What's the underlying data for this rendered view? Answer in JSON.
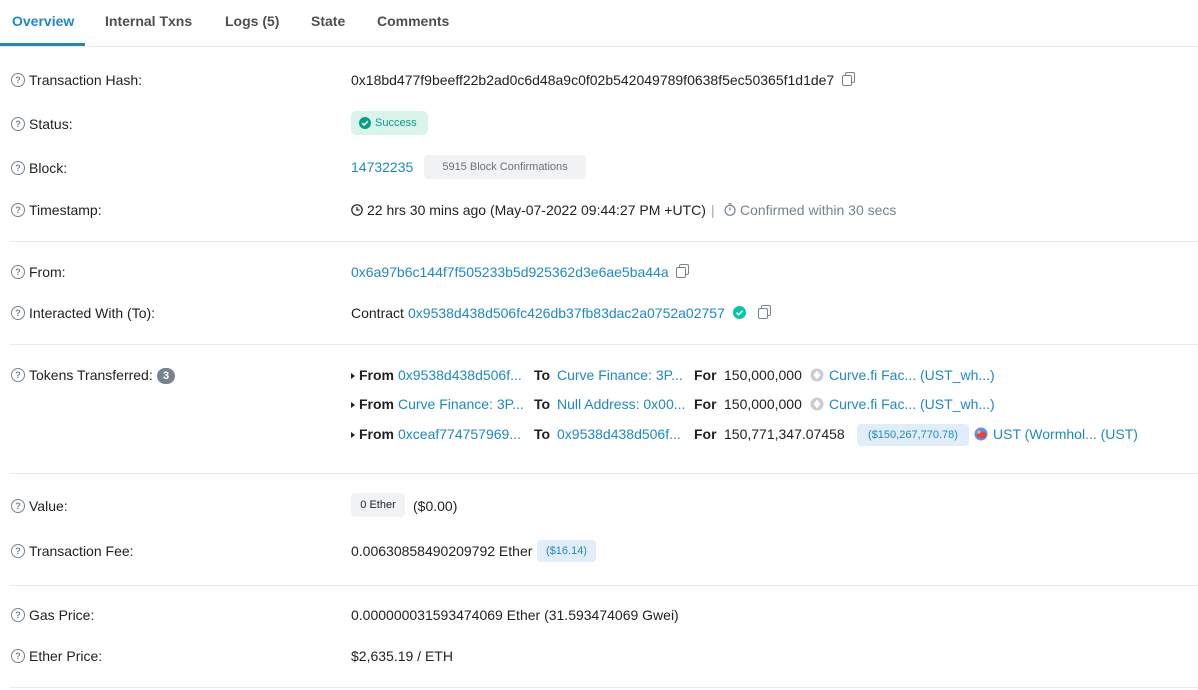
{
  "tabs": [
    "Overview",
    "Internal Txns",
    "Logs (5)",
    "State",
    "Comments"
  ],
  "rows": {
    "tx_hash": {
      "label": "Transaction Hash:",
      "value": "0x18bd477f9beeff22b2ad0c6d48a9c0f02b542049789f0638f5ec50365f1d1de7"
    },
    "status": {
      "label": "Status:",
      "value": "Success"
    },
    "block": {
      "label": "Block:",
      "value": "14732235",
      "confirmations": "5915 Block Confirmations"
    },
    "timestamp": {
      "label": "Timestamp:",
      "value": "22 hrs 30 mins ago (May-07-2022 09:44:27 PM +UTC)",
      "separator": "|",
      "confirmed": "Confirmed within 30 secs"
    },
    "from": {
      "label": "From:",
      "value": "0x6a97b6c144f7f505233b5d925362d3e6ae5ba44a"
    },
    "to": {
      "label": "Interacted With (To):",
      "prefix": "Contract",
      "value": "0x9538d438d506fc426db37fb83dac2a0752a02757"
    },
    "tokens": {
      "label": "Tokens Transferred:",
      "count": "3"
    },
    "value": {
      "label": "Value:",
      "amount": "0 Ether",
      "usd": "($0.00)"
    },
    "fee": {
      "label": "Transaction Fee:",
      "amount": "0.00630858490209792 Ether",
      "usd": "($16.14)"
    },
    "gas": {
      "label": "Gas Price:",
      "value": "0.000000031593474069 Ether (31.593474069 Gwei)"
    },
    "ether_price": {
      "label": "Ether Price:",
      "value": "$2,635.19 / ETH"
    }
  },
  "transfers": [
    {
      "from_kw": "From",
      "from": "0x9538d438d506f...",
      "to_kw": "To",
      "to": "Curve Finance: 3P...",
      "for_kw": "For",
      "amount": "150,000,000",
      "usd": "",
      "token": "Curve.fi Fac... (UST_wh...)"
    },
    {
      "from_kw": "From",
      "from": "Curve Finance: 3P...",
      "to_kw": "To",
      "to": "Null Address: 0x00...",
      "for_kw": "For",
      "amount": "150,000,000",
      "usd": "",
      "token": "Curve.fi Fac... (UST_wh...)"
    },
    {
      "from_kw": "From",
      "from": "0xceaf774757969...",
      "to_kw": "To",
      "to": "0x9538d438d506f...",
      "for_kw": "For",
      "amount": "150,771,347.07458",
      "usd": "($150,267,770.78)",
      "token": "UST (Wormhol... (UST)"
    }
  ],
  "icons": {
    "help": "question-circle-icon",
    "copy": "copy-icon",
    "check": "check-circle-icon",
    "clock": "clock-icon",
    "stopwatch": "stopwatch-icon",
    "token_curve": "curve-token-icon",
    "token_ust": "ust-token-icon"
  },
  "colors": {
    "link": "#1e88c7",
    "success": "#00a186",
    "success_bg": "#daf4eb",
    "border": "#e7eaf3"
  }
}
